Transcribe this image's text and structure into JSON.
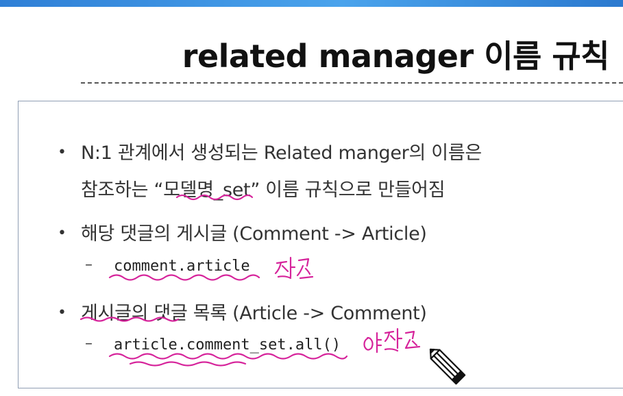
{
  "slide": {
    "title": "related manager 이름 규칙"
  },
  "bullets": {
    "b1_line1": "N:1 관계에서 생성되는 Related manger의 이름은",
    "b1_line2": "참조하는 “모델명_set” 이름 규칙으로 만들어짐",
    "b2": "해당 댓글의 게시글 (Comment -> Article)",
    "b2_sub": "comment.article",
    "b3": "게시글의 댓글 목록 (Article -> Comment)",
    "b3_sub": "article.comment_set.all()"
  },
  "annotations": {
    "ink_color": "#d6249b",
    "note_reference": "참조",
    "note_reverse_reference": "역참조",
    "cursor_icon": "pencil-cursor-icon"
  }
}
